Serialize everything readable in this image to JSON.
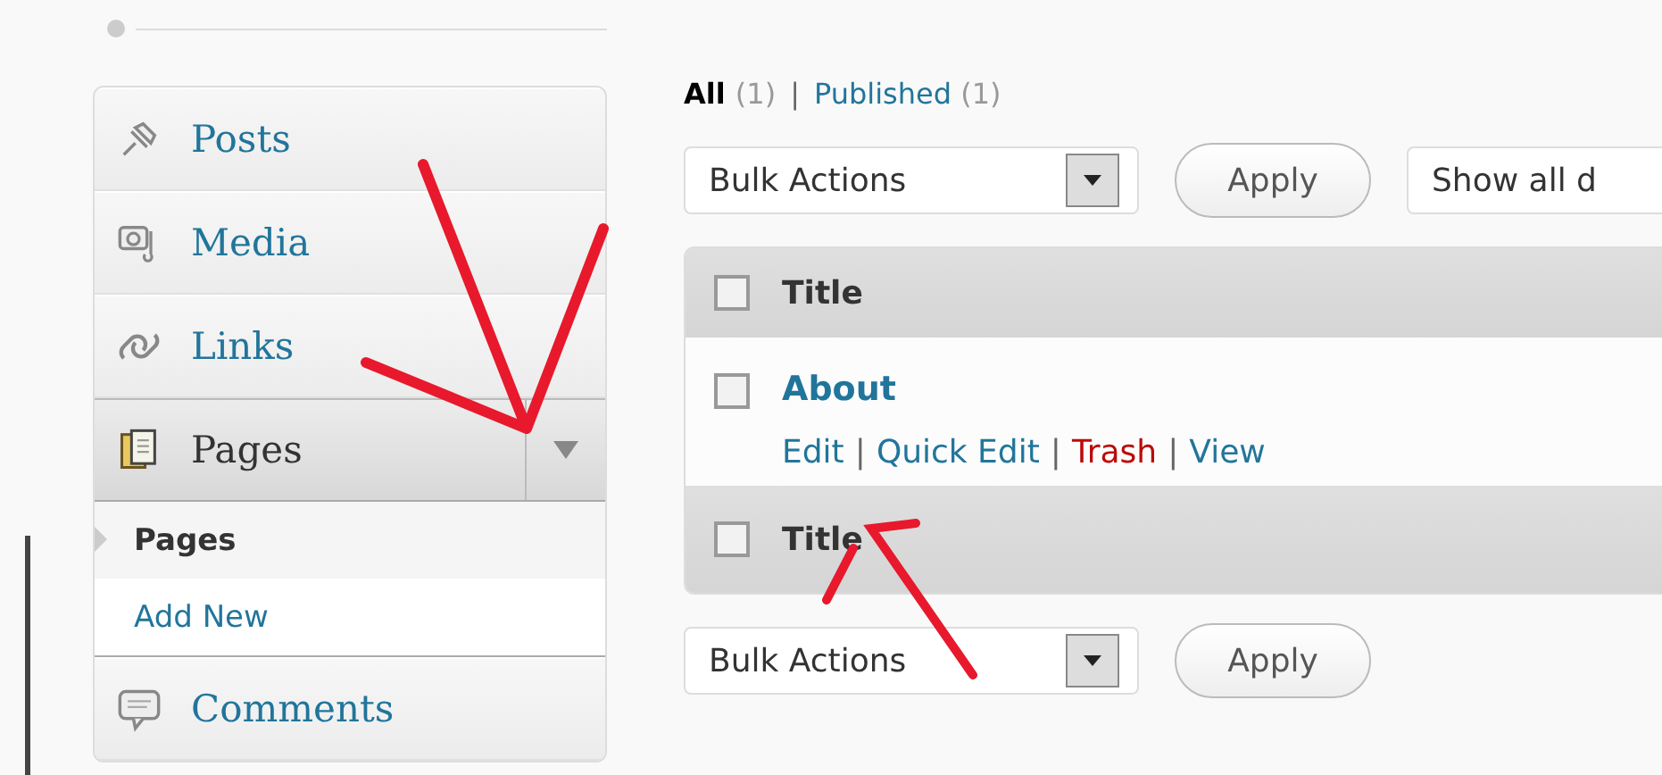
{
  "sidebar": {
    "items": [
      {
        "label": "Posts",
        "selected": false
      },
      {
        "label": "Media",
        "selected": false
      },
      {
        "label": "Links",
        "selected": false
      },
      {
        "label": "Pages",
        "selected": true,
        "expanded": true,
        "children": [
          {
            "label": "Pages",
            "selected": true
          },
          {
            "label": "Add New",
            "selected": false
          }
        ]
      },
      {
        "label": "Comments",
        "selected": false
      }
    ]
  },
  "filters": [
    {
      "label": "All",
      "count": "(1)",
      "selected": true
    },
    {
      "separator": "|",
      "label": "Published",
      "count": "(1)",
      "selected": false
    }
  ],
  "top_toolbar": {
    "bulk_select": "Bulk Actions",
    "apply": "Apply",
    "filter_select": "Show all d"
  },
  "table": {
    "header": "Title",
    "header_checked": false,
    "rows": [
      {
        "title": "About",
        "checked": false,
        "actions": [
          {
            "kind": "link",
            "label": "Edit"
          },
          {
            "kind": "link",
            "separator": "|",
            "label": "Quick Edit"
          },
          {
            "kind": "danger",
            "separator": "|",
            "label": "Trash"
          },
          {
            "kind": "link",
            "separator": "|",
            "label": "View"
          }
        ]
      }
    ],
    "footer": "Title",
    "footer_checked": false
  },
  "bottom_toolbar": {
    "bulk_select": "Bulk Actions",
    "apply": "Apply"
  }
}
